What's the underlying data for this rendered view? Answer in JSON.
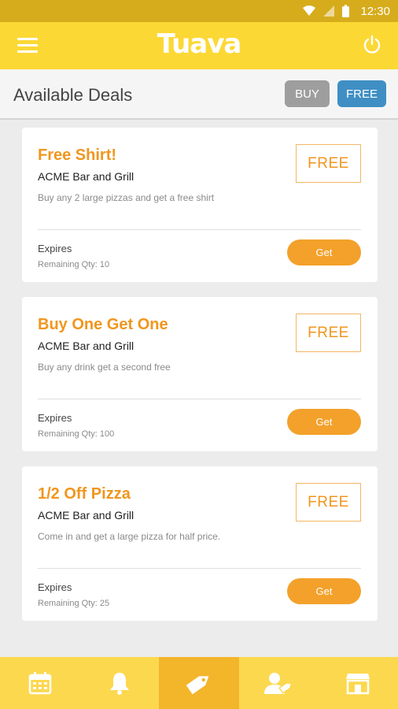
{
  "status_bar": {
    "time": "12:30"
  },
  "app_bar": {
    "logo_text": "Tuava",
    "menu_icon": "hamburger-menu-icon",
    "power_icon": "power-icon"
  },
  "header": {
    "title": "Available Deals",
    "filters": [
      {
        "label": "BUY",
        "color": "#9e9e9e"
      },
      {
        "label": "FREE",
        "color": "#3f8fc4"
      }
    ]
  },
  "deals": [
    {
      "title": "Free Shirt!",
      "merchant": "ACME Bar and Grill",
      "description": "Buy any 2 large pizzas and get a free shirt",
      "badge": "FREE",
      "expires_label": "Expires",
      "remaining": "Remaining Qty: 10",
      "action_label": "Get"
    },
    {
      "title": "Buy One Get One",
      "merchant": "ACME Bar and Grill",
      "description": "Buy any drink get a second free",
      "badge": "FREE",
      "expires_label": "Expires",
      "remaining": "Remaining Qty: 100",
      "action_label": "Get"
    },
    {
      "title": "1/2 Off Pizza",
      "merchant": "ACME Bar and Grill",
      "description": "Come in and get a large pizza for half price.",
      "badge": "FREE",
      "expires_label": "Expires",
      "remaining": "Remaining Qty: 25",
      "action_label": "Get"
    }
  ],
  "bottom_nav": {
    "items": [
      {
        "icon": "calendar-icon",
        "active": false
      },
      {
        "icon": "bell-icon",
        "active": false
      },
      {
        "icon": "tag-icon",
        "active": true
      },
      {
        "icon": "user-tag-icon",
        "active": false
      },
      {
        "icon": "store-icon",
        "active": false
      }
    ]
  },
  "colors": {
    "status_bar": "#d6ac1d",
    "app_bar": "#fcd835",
    "accent_orange": "#f0961e",
    "get_button": "#f3a12b",
    "nav_active": "#f3b52a"
  }
}
